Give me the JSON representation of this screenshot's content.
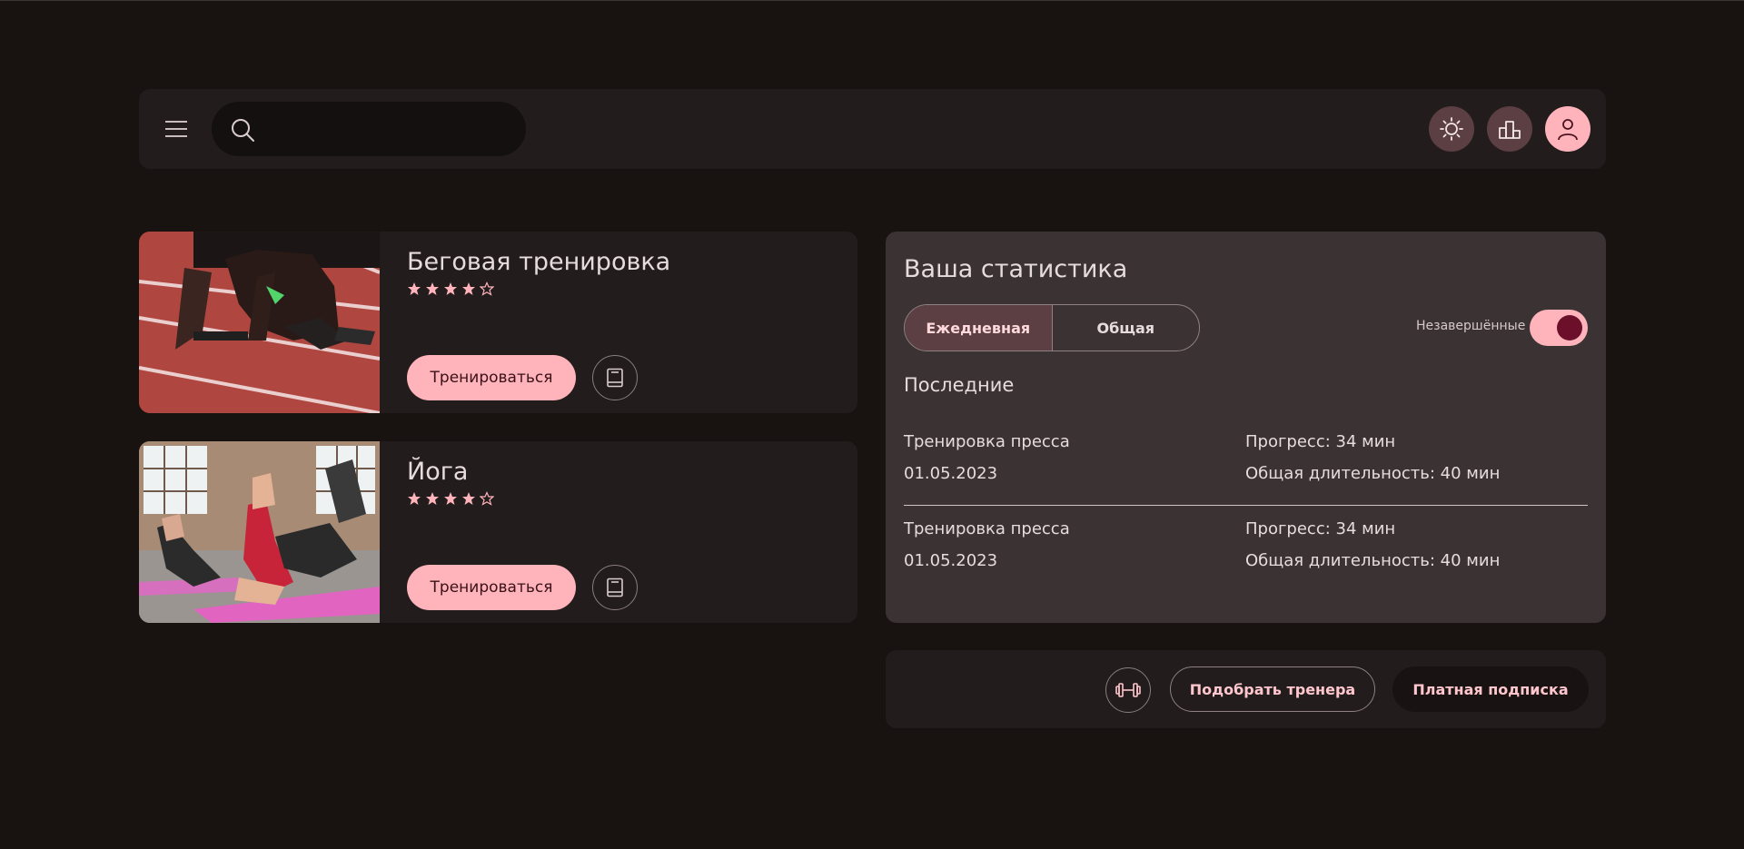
{
  "header": {
    "search": {
      "placeholder": "",
      "value": ""
    },
    "icons": {
      "menu": "menu-icon",
      "search": "search-icon",
      "theme": "sun-icon",
      "rank": "podium-icon",
      "profile": "user-icon"
    }
  },
  "workouts": [
    {
      "title": "Беговая тренировка",
      "rating": 4,
      "max_rating": 5,
      "train_label": "Тренироваться",
      "image": "sprinter-on-track-photo"
    },
    {
      "title": "Йога",
      "rating": 4,
      "max_rating": 5,
      "train_label": "Тренироваться",
      "image": "women-yoga-class-photo"
    }
  ],
  "stats": {
    "title": "Ваша статистика",
    "tabs": [
      {
        "label": "Ежедневная",
        "active": true
      },
      {
        "label": "Общая",
        "active": false
      }
    ],
    "toggle": {
      "label": "Незавершённые",
      "on": true
    },
    "recent_title": "Последние",
    "recent": [
      {
        "name": "Тренировка пресса",
        "date": "01.05.2023",
        "progress": "Прогресс: 34 мин",
        "duration": "Общая длительность: 40 мин"
      },
      {
        "name": "Тренировка пресса",
        "date": "01.05.2023",
        "progress": "Прогресс: 34 мин",
        "duration": "Общая длительность: 40 мин"
      }
    ]
  },
  "actions": {
    "coach_label": "Подобрать тренера",
    "subscription_label": "Платная подписка",
    "dumbbell_icon": "dumbbell-icon"
  },
  "colors": {
    "background": "#181211",
    "panel": "#221c1c",
    "stats_panel": "#3a3233",
    "accent": "#ffb3bb",
    "accent_dark": "#5c3f42",
    "toggle_knob": "#6b0f2a"
  }
}
